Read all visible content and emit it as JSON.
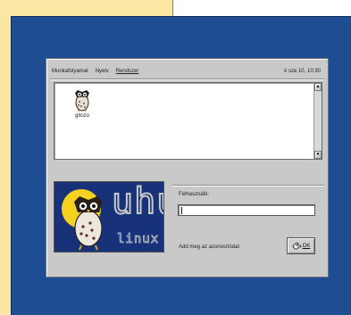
{
  "menubar": {
    "items": [
      "Munkafolyamat",
      "Nyelv",
      "Rendszer"
    ],
    "clock": "k sze 10, 10:30"
  },
  "userlist": {
    "users": [
      {
        "name": "gitozo",
        "icon": "owl-avatar-icon"
      }
    ],
    "scroll_up": "▲",
    "scroll_down": "▼"
  },
  "logo": {
    "wordmark": "uhu",
    "subtitle": "linux",
    "colors": {
      "background": "#18327a",
      "sun": "#f4d21f",
      "text": "#c9c9c9"
    }
  },
  "login": {
    "label": "Felhasználó:",
    "value": "",
    "prompt": "Add meg az azonosítódat",
    "ok_label": "OK"
  },
  "colors": {
    "desktop_left": "#fbe7a3",
    "frame_blue": "#1f4d92",
    "dialog_gray": "#c9c9c9"
  }
}
